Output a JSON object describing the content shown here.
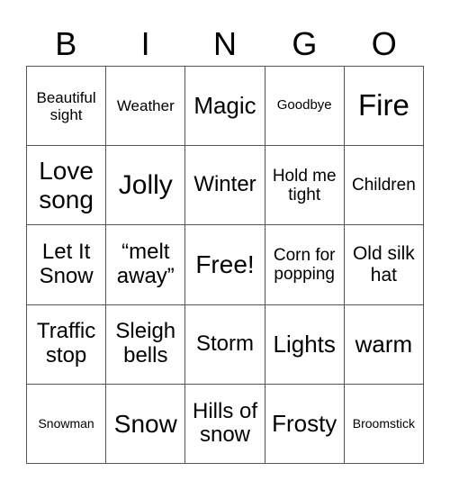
{
  "header": {
    "letters": [
      "B",
      "I",
      "N",
      "G",
      "O"
    ]
  },
  "cells": [
    "Beautiful sight",
    "Weather",
    "Magic",
    "Goodbye",
    "Fire",
    "Love song",
    "Jolly",
    "Winter",
    "Hold me tight",
    "Children",
    "Let It Snow",
    "“melt away”",
    "Free!",
    "Corn for popping",
    "Old silk hat",
    "Traffic stop",
    "Sleigh bells",
    "Storm",
    "Lights",
    "warm",
    "Snowman",
    "Snow",
    "Hills of snow",
    "Frosty",
    "Broomstick"
  ]
}
